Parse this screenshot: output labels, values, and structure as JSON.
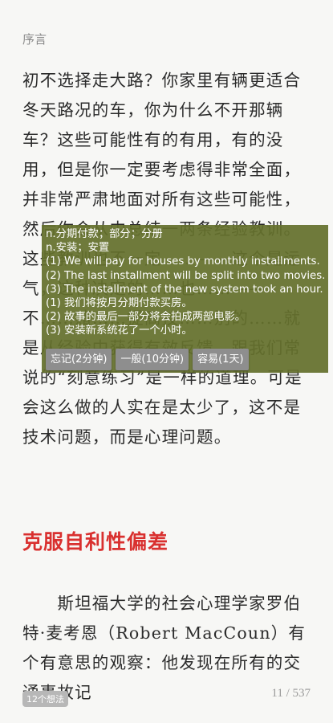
{
  "header": {
    "title": "序言"
  },
  "body": {
    "para1": "初不选择走大路？你家里有辆更适合冬天路况的车，你为什么不开那辆车？",
    "para2": "　　这些可能性有的有用，有的没用，但是你一定要考虑得非常全面，并非常严肃地面对所有这些可能性，然后你会从中总结一两条经验教训。这些教训也不一定……——这个是运气，这种决定的……也……——不……赌……提高技……别的……就是从经验中获得有效反馈，跟我们常说的“刻意练习”是一样的道理。可是会这么做的人实在是太少了，这不是技术问题，而是心理问题。",
    "section_title": "克服自利性偏差",
    "para3": "　　斯坦福大学的社会心理学家罗伯特·麦考恩（Robert MacCoun）有个有意思的观察：他发现在所有的交通事故记"
  },
  "dictionary_popup": {
    "defs": [
      "n.分期付款；部分；分册",
      "n.安装；安置",
      "(1) We will pay for houses by monthly installments.",
      "(2) The last installment will be split into two movies.",
      "(3) The installment of the new system took an hour.",
      "(1) 我们将按月分期付款买房。",
      "(2) 故事的最后一部分将会拍成两部电影。",
      "(3) 安装新系统花了一个小时。"
    ],
    "buttons": {
      "forget": "忘记(2分钟)",
      "normal": "一般(10分钟)",
      "easy": "容易(1天)"
    }
  },
  "footer": {
    "notes_badge": "12个想法",
    "page_indicator": "11 / 537"
  },
  "colors": {
    "popup_bg": "#64702c",
    "section_title": "#d9302f",
    "button_bg": "#8e8e8e"
  }
}
